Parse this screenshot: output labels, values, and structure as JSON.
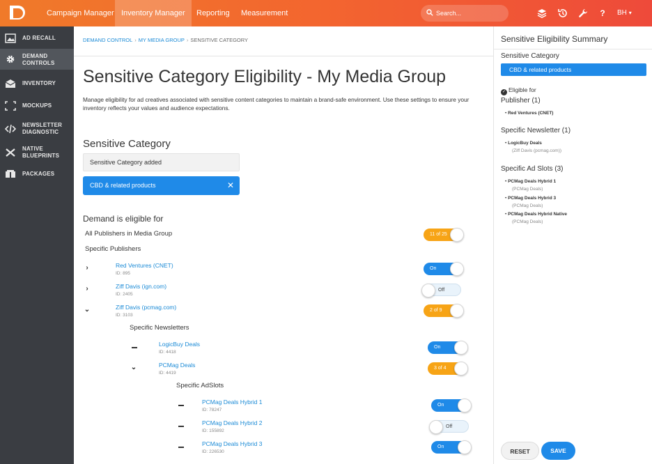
{
  "topbar": {
    "nav": [
      {
        "label": "Campaign Manager",
        "active": false
      },
      {
        "label": "Inventory Manager",
        "active": true
      },
      {
        "label": "Reporting",
        "active": false
      },
      {
        "label": "Measurement",
        "active": false
      }
    ],
    "search_placeholder": "Search...",
    "user_initials": "BH"
  },
  "sidebar": {
    "items": [
      {
        "label": "Ad Recall",
        "icon": "image-icon",
        "active": false
      },
      {
        "label": "Demand Controls",
        "icon": "gear-icon",
        "active": true
      },
      {
        "label": "Inventory",
        "icon": "inbox-icon",
        "active": false
      },
      {
        "label": "Mockups",
        "icon": "frame-icon",
        "active": false
      },
      {
        "label": "Newsletter Diagnostic",
        "icon": "code-icon",
        "active": false
      },
      {
        "label": "Native Blueprints",
        "icon": "tools-icon",
        "active": false
      },
      {
        "label": "Packages",
        "icon": "packages-icon",
        "active": false
      }
    ]
  },
  "main": {
    "breadcrumb": [
      "Demand Control",
      "My Media Group",
      "Sensitive Category"
    ],
    "title": "Sensitive Category Eligibility - My Media Group",
    "description": "Manage eligibility for ad creatives associated with sensitive content categories to maintain a brand-safe environment. Use these settings to ensure your inventory reflects your values and audience expectations.",
    "sensitive_category_heading": "Sensitive Category",
    "sensitive_category_added": "Sensitive Category added",
    "selected_category": "CBD & related products",
    "demand_heading": "Demand is eligible for",
    "all_publishers_label": "All Publishers in Media Group",
    "all_publishers_toggle": "11 of 25",
    "specific_publishers_label": "Specific Publishers",
    "publishers": [
      {
        "name": "Red Ventures (CNET)",
        "id": "ID: 895",
        "toggle": "On",
        "state": "on"
      },
      {
        "name": "Ziff Davis (ign.com)",
        "id": "ID: 2405",
        "toggle": "Off",
        "state": "off"
      },
      {
        "name": "Ziff Davis (pcmag.com)",
        "id": "ID: 3103",
        "toggle": "2 of 9",
        "state": "partial"
      }
    ],
    "specific_newsletters_label": "Specific Newsletters",
    "newsletters": [
      {
        "name": "LogicBuy Deals",
        "id": "ID: 4418",
        "toggle": "On",
        "state": "on"
      },
      {
        "name": "PCMag Deals",
        "id": "ID: 4419",
        "toggle": "3 of 4",
        "state": "partial"
      }
    ],
    "specific_adslots_label": "Specific AdSlots",
    "adslots": [
      {
        "name": "PCMag Deals Hybrid 1",
        "id": "ID: 78247",
        "toggle": "On",
        "state": "on"
      },
      {
        "name": "PCMag Deals Hybrid 2",
        "id": "ID: 155892",
        "toggle": "Off",
        "state": "off"
      },
      {
        "name": "PCMag Deals Hybrid 3",
        "id": "ID: 226530",
        "toggle": "On",
        "state": "on"
      }
    ]
  },
  "summary": {
    "title": "Sensitive Eligibility Summary",
    "category_label": "Sensitive Category",
    "category_value": "CBD & related products",
    "eligible_for": "Eligible for",
    "publisher_heading": "Publisher (1)",
    "publisher_items": [
      {
        "name": "Red Ventures (CNET)"
      }
    ],
    "newsletter_heading": "Specific Newsletter (1)",
    "newsletter_items": [
      {
        "name": "LogicBuy Deals",
        "sub": "(Ziff Davis (pcmag.com))"
      }
    ],
    "adslot_heading": "Specific Ad Slots (3)",
    "adslot_items": [
      {
        "name": "PCMag Deals Hybrid 1",
        "sub": "(PCMag Deals)"
      },
      {
        "name": "PCMag Deals Hybrid 3",
        "sub": "(PCMag Deals)"
      },
      {
        "name": "PCMag Deals Hybrid Native",
        "sub": "(PCMag Deals)"
      }
    ],
    "reset_label": "Reset",
    "save_label": "Save"
  },
  "colors": {
    "accent": "#1f8ae8",
    "partial": "#f7a416",
    "topbar_start": "#f07a2a",
    "topbar_end": "#ee4a3a",
    "sidebar": "#3a3d42"
  }
}
